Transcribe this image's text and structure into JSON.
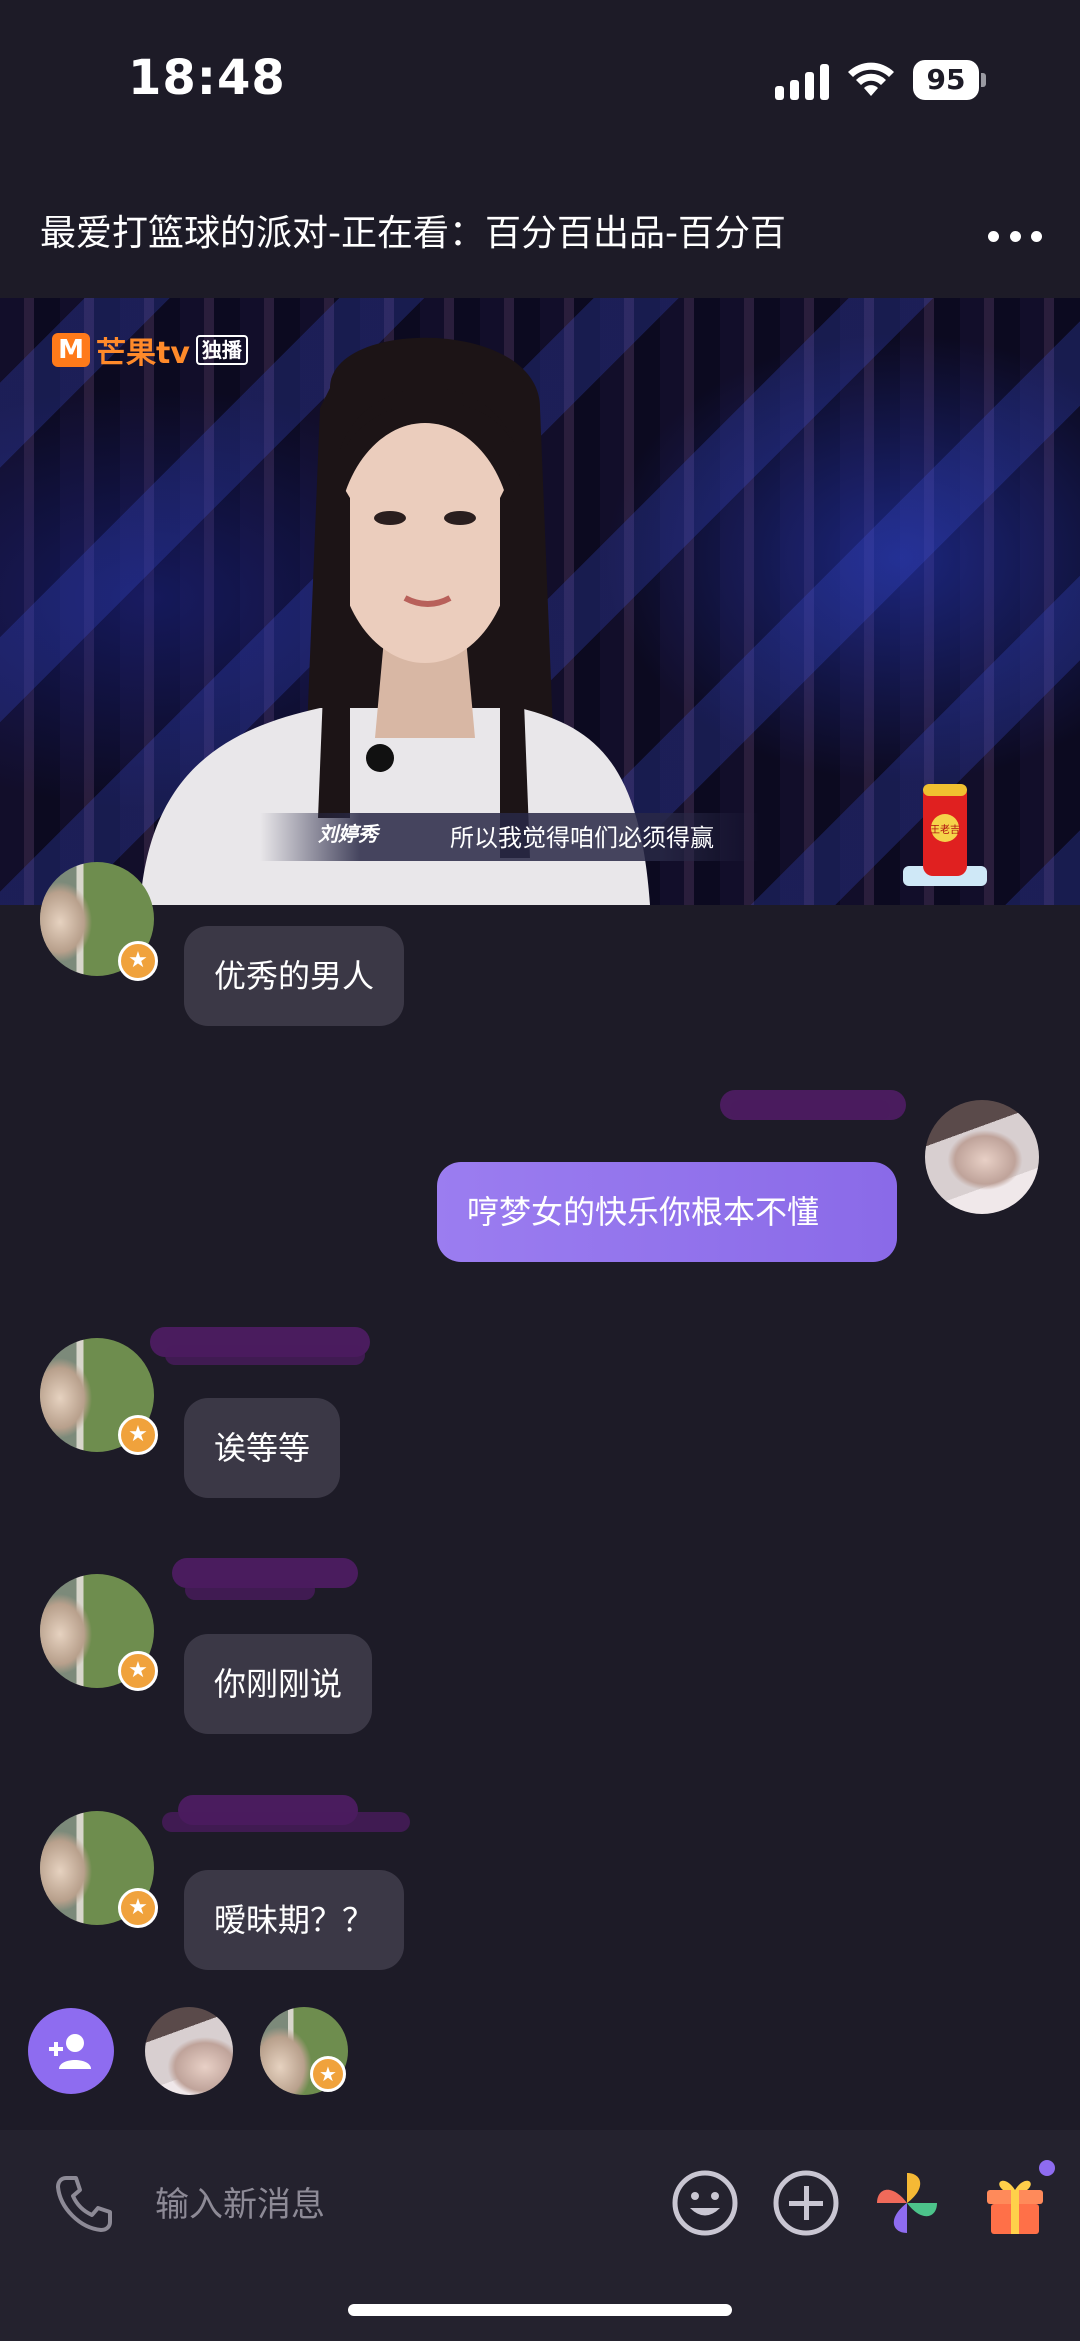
{
  "status_bar": {
    "time": "18:48",
    "battery": "95"
  },
  "header": {
    "title": "最爱打篮球的派对-正在看：百分百出品-百分百"
  },
  "video": {
    "logo_text": "芒果tv",
    "logo_badge": "独播",
    "speaker": "刘婷秀",
    "subtitle": "所以我觉得咱们必须得赢",
    "can_label": "王老吉"
  },
  "messages": [
    {
      "side": "left",
      "text": "优秀的男人"
    },
    {
      "side": "right",
      "text": "哼梦女的快乐你根本不懂"
    },
    {
      "side": "left",
      "text": "诶等等"
    },
    {
      "side": "left",
      "text": "你刚刚说"
    },
    {
      "side": "left",
      "text": "暧昧期？？"
    }
  ],
  "composer": {
    "placeholder": "输入新消息"
  },
  "colors": {
    "background": "#1d1b27",
    "accent": "#8e6cf0",
    "bubble_left": "#3b3846",
    "star": "#f0a23c"
  }
}
